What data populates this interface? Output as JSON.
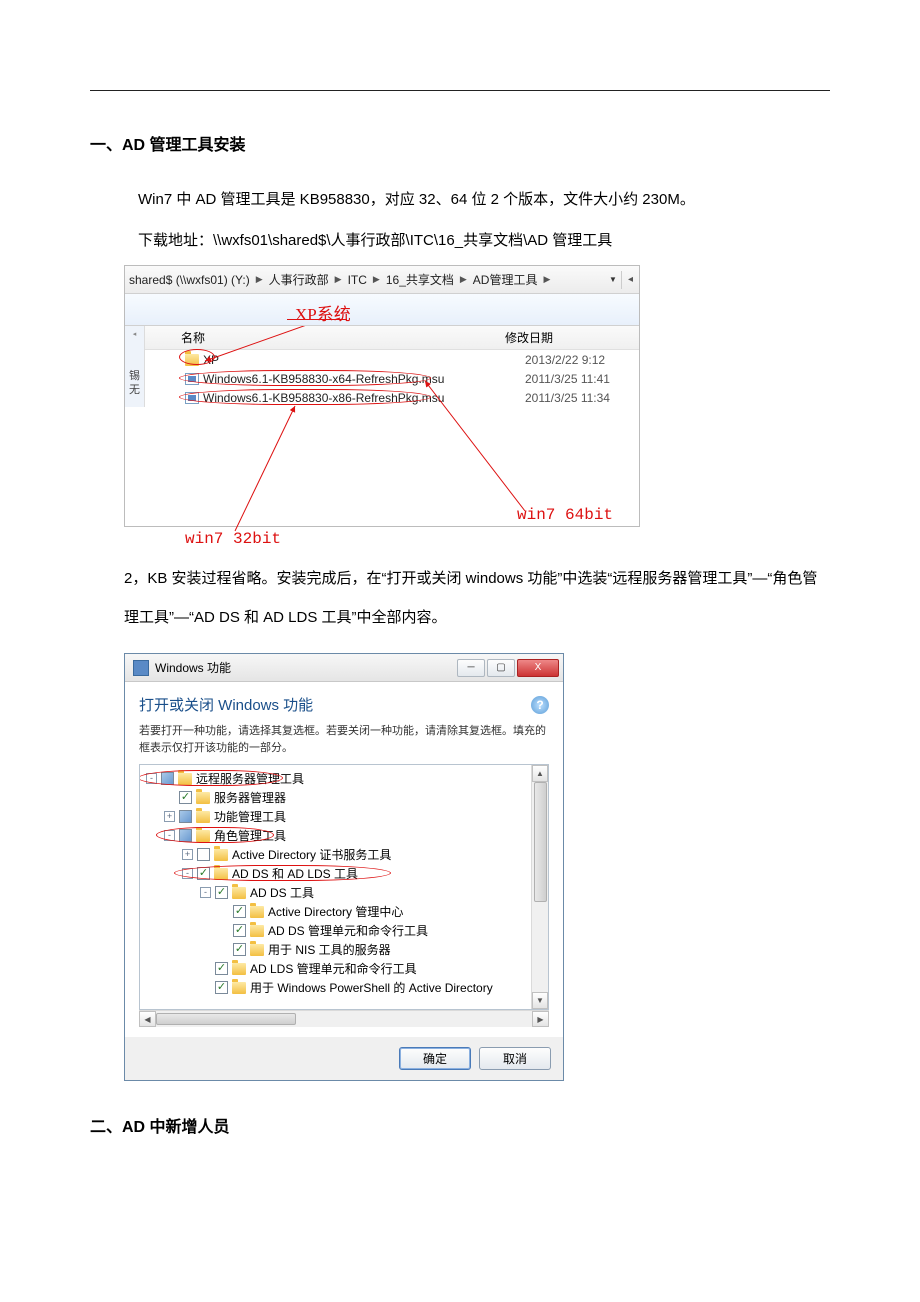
{
  "doc": {
    "section1_title": "一、AD 管理工具安装",
    "p1": "Win7 中 AD 管理工具是 KB958830，对应 32、64 位 2 个版本，文件大小约 230M。",
    "p2": "下载地址：\\\\wxfs01\\shared$\\人事行政部\\ITC\\16_共享文档\\AD 管理工具",
    "p3": "2，KB 安装过程省略。安装完成后，在“打开或关闭 windows 功能”中选装“远程服务器管理工具”—“角色管理工具”—“AD DS 和 AD LDS 工具”中全部内容。",
    "section2_title": "二、AD 中新增人员"
  },
  "explorer": {
    "breadcrumb": [
      "shared$ (\\\\wxfs01) (Y:)",
      "人事行政部",
      "ITC",
      "16_共享文档",
      "AD管理工具"
    ],
    "xp_label": "XP系统",
    "col_name": "名称",
    "col_date": "修改日期",
    "rows": [
      {
        "name": "XP",
        "date": "2013/2/22 9:12",
        "type": "folder"
      },
      {
        "name": "Windows6.1-KB958830-x64-RefreshPkg.msu",
        "date": "2011/3/25 11:41",
        "type": "msu"
      },
      {
        "name": "Windows6.1-KB958830-x86-RefreshPkg.msu",
        "date": "2011/3/25 11:34",
        "type": "msu"
      }
    ],
    "side": {
      "r1": "锡",
      "r2": "无"
    },
    "ann64": "win7 64bit",
    "ann32": "win7 32bit"
  },
  "wf": {
    "title": "Windows 功能",
    "heading": "打开或关闭 Windows 功能",
    "desc": "若要打开一种功能，请选择其复选框。若要关闭一种功能，请清除其复选框。填充的框表示仅打开该功能的一部分。",
    "ok": "确定",
    "cancel": "取消",
    "tree": [
      {
        "indent": 0,
        "exp": "-",
        "chk": "f",
        "label": "远程服务器管理工具",
        "circle": true
      },
      {
        "indent": 1,
        "exp": "",
        "chk": "c",
        "label": "服务器管理器"
      },
      {
        "indent": 1,
        "exp": "+",
        "chk": "f",
        "label": "功能管理工具"
      },
      {
        "indent": 1,
        "exp": "-",
        "chk": "f",
        "label": "角色管理工具",
        "circle": true
      },
      {
        "indent": 2,
        "exp": "+",
        "chk": "",
        "label": "Active Directory 证书服务工具"
      },
      {
        "indent": 2,
        "exp": "-",
        "chk": "c",
        "label": "AD DS 和 AD LDS 工具",
        "circle": true
      },
      {
        "indent": 3,
        "exp": "-",
        "chk": "c",
        "label": "AD DS 工具"
      },
      {
        "indent": 4,
        "exp": "",
        "chk": "c",
        "label": "Active Directory 管理中心"
      },
      {
        "indent": 4,
        "exp": "",
        "chk": "c",
        "label": "AD DS 管理单元和命令行工具"
      },
      {
        "indent": 4,
        "exp": "",
        "chk": "c",
        "label": "用于 NIS 工具的服务器"
      },
      {
        "indent": 3,
        "exp": "",
        "chk": "c",
        "label": "AD LDS 管理单元和命令行工具"
      },
      {
        "indent": 3,
        "exp": "",
        "chk": "c",
        "label": "用于 Windows PowerShell 的 Active Directory"
      }
    ]
  }
}
